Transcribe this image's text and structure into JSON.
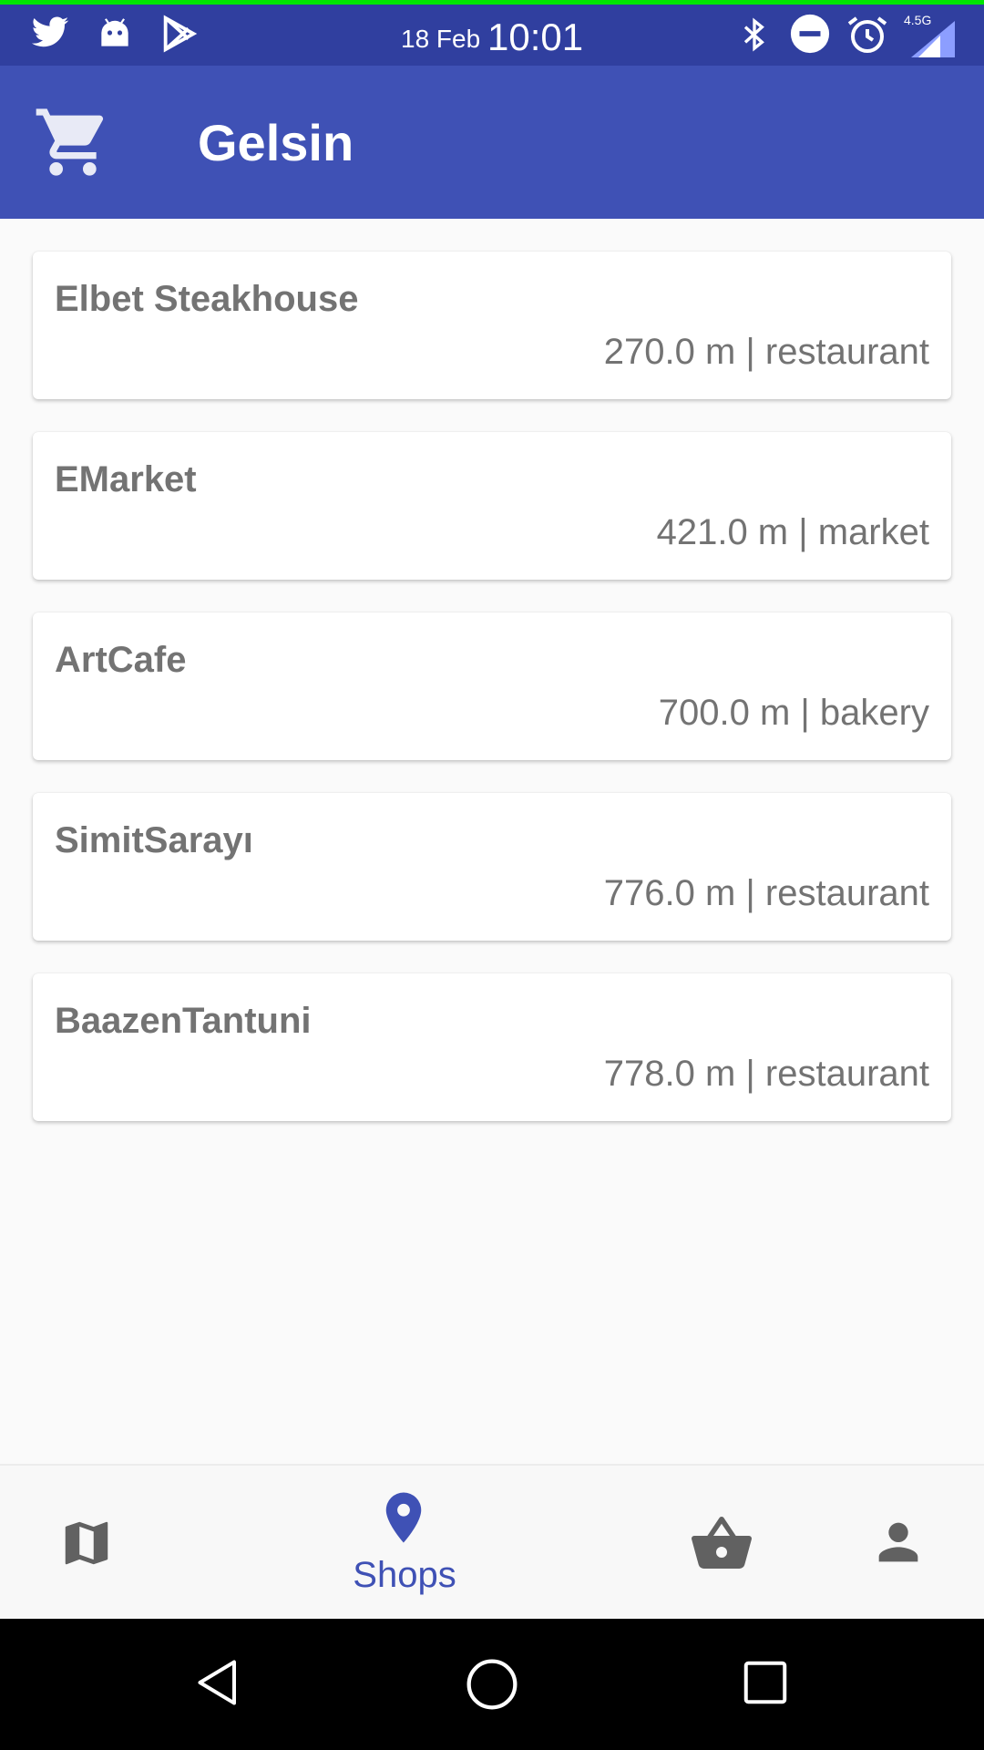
{
  "status_bar": {
    "date": "18 Feb",
    "time": "10:01",
    "network": "4.5G",
    "left_icons": [
      "twitter-icon",
      "android-icon",
      "play-store-icon"
    ],
    "right_icons": [
      "bluetooth-icon",
      "do-not-disturb-icon",
      "alarm-icon",
      "signal-icon"
    ]
  },
  "app_bar": {
    "title": "Gelsin",
    "icon": "cart-icon",
    "color": "#3f51b5"
  },
  "shops": [
    {
      "name": "Elbet Steakhouse",
      "meta": "270.0 m | restaurant"
    },
    {
      "name": "EMarket",
      "meta": "421.0 m | market"
    },
    {
      "name": "ArtCafe",
      "meta": "700.0 m | bakery"
    },
    {
      "name": "SimitSarayı",
      "meta": "776.0 m | restaurant"
    },
    {
      "name": "BaazenTantuni",
      "meta": "778.0 m | restaurant"
    }
  ],
  "bottom_nav": {
    "items": [
      {
        "icon": "map-icon",
        "label": "",
        "active": false
      },
      {
        "icon": "location-pin-icon",
        "label": "Shops",
        "active": true
      },
      {
        "icon": "basket-icon",
        "label": "",
        "active": false
      },
      {
        "icon": "person-icon",
        "label": "",
        "active": false
      }
    ],
    "active_color": "#3f51b5",
    "inactive_color": "#616161"
  },
  "system_nav": {
    "buttons": [
      "back-icon",
      "home-icon",
      "recents-icon"
    ]
  }
}
